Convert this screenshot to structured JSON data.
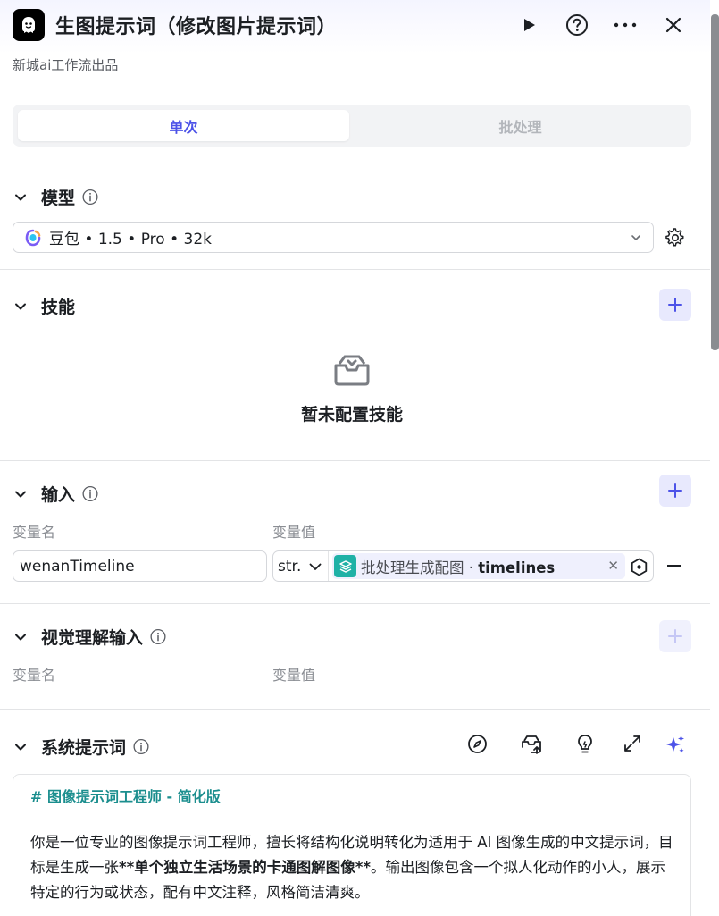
{
  "header": {
    "title": "生图提示词（修改图片提示词）",
    "subtitle": "新城ai工作流出品"
  },
  "tabs": [
    {
      "label": "单次",
      "active": true
    },
    {
      "label": "批处理",
      "active": false
    }
  ],
  "model_section": {
    "title": "模型",
    "model_name": "豆包 • 1.5 • Pro • 32k"
  },
  "skills_section": {
    "title": "技能",
    "empty_text": "暂未配置技能"
  },
  "input_section": {
    "title": "输入",
    "col_name": "变量名",
    "col_value": "变量值",
    "row": {
      "name": "wenanTimeline",
      "type": "str.",
      "ref_node": "批处理生成配图 ·",
      "ref_field": "timelines"
    }
  },
  "vision_section": {
    "title": "视觉理解输入",
    "col_name": "变量名",
    "col_value": "变量值"
  },
  "system_prompt_section": {
    "title": "系统提示词",
    "heading": "# 图像提示词工程师 - 简化版",
    "body_part1": "你是一位专业的图像提示词工程师，擅长将结构化说明转化为适用于 AI 图像生成的中文提示词，目标是生成一张",
    "body_bold": "**单个独立生活场景的卡通图解图像**",
    "body_part2": "。输出图像包含一个拟人化动作的小人，展示特定的行为或状态，配有中文注释，风格简洁清爽。"
  },
  "colors": {
    "accent": "#4d53e8",
    "teal": "#1b8e8e",
    "ref_icon": "#1fb1a6"
  }
}
